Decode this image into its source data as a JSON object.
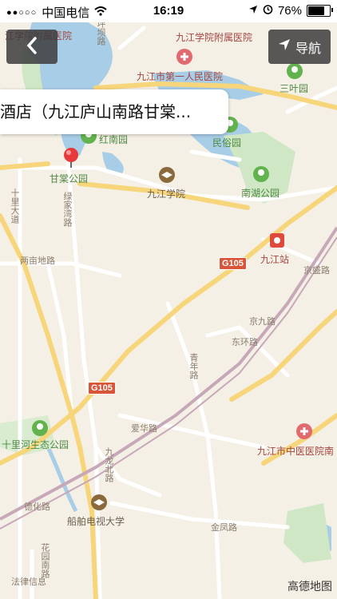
{
  "status_bar": {
    "signal": "●●○○○",
    "carrier": "中国电信",
    "time": "16:19",
    "battery": "76%",
    "battery_level": 0.76
  },
  "toolbar": {
    "back_icon": "chevron-left-icon",
    "nav_label": "导航",
    "nav_icon": "location-arrow-icon"
  },
  "callout": {
    "text": "酒店（九江庐山南路甘棠..."
  },
  "map": {
    "brand": "高德地图",
    "labels": {
      "hospital_top_left": "江学院附属医院",
      "hospital_top": "九江学院附属医院",
      "hospital_first": "九江市第一人民医院",
      "sanyeyuan": "三叶园",
      "hongnanyuan": "红南园",
      "minsuyuan": "民俗园",
      "gantang_park": "甘棠公园",
      "jiujiang_college": "九江学院",
      "nanhu_park": "南湖公园",
      "station": "九江站",
      "shilihe": "十里河生态公园",
      "tcm_hospital": "九江市中医医院南",
      "tv_university": "船舶电视大学",
      "road_shili": "十里大道",
      "road_liangnan": "两亩地路",
      "road_jingxiu": "绿家湾路",
      "road_jingshan": "京九路",
      "road_jingchang": "京盛路",
      "road_jinghu": "东环路",
      "road_qingnian": "青年路",
      "road_aihua": "爱华路",
      "road_jiufeng": "九龙北路",
      "road_dehua": "德化路",
      "road_jinfeng": "金凤路",
      "road_huayuan": "花园南路",
      "road_falv": "法律信息",
      "road_tanpo": "坪坝路",
      "shield_top": "G105",
      "shield_bottom": "G105"
    }
  }
}
